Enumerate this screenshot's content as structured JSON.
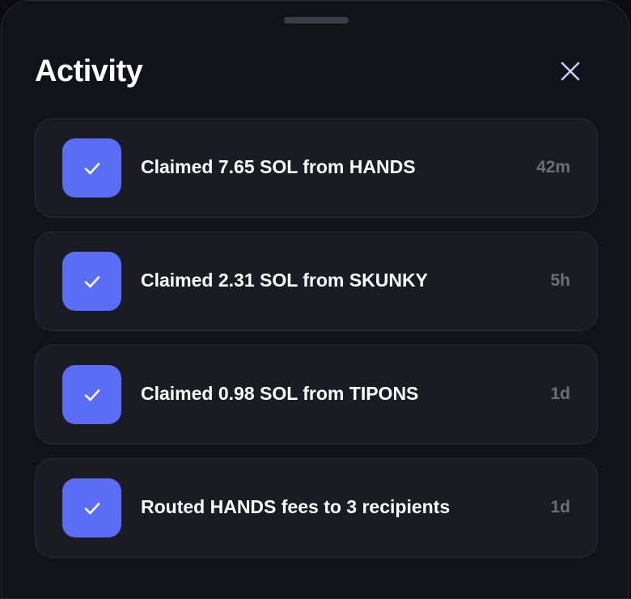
{
  "panel": {
    "title": "Activity",
    "close_icon": "close-icon"
  },
  "activity": {
    "items": [
      {
        "label": "Claimed 7.65 SOL from HANDS",
        "time": "42m",
        "icon": "checkmark-icon"
      },
      {
        "label": "Claimed 2.31 SOL from SKUNKY",
        "time": "5h",
        "icon": "checkmark-icon"
      },
      {
        "label": "Claimed 0.98 SOL from TIPONS",
        "time": "1d",
        "icon": "checkmark-icon"
      },
      {
        "label": "Routed HANDS fees to 3 recipients",
        "time": "1d",
        "icon": "checkmark-icon"
      }
    ]
  },
  "colors": {
    "background": "#121219",
    "card": "#1b1b24",
    "accent": "#5b6cf5",
    "muted_text": "#6e6e7a"
  }
}
